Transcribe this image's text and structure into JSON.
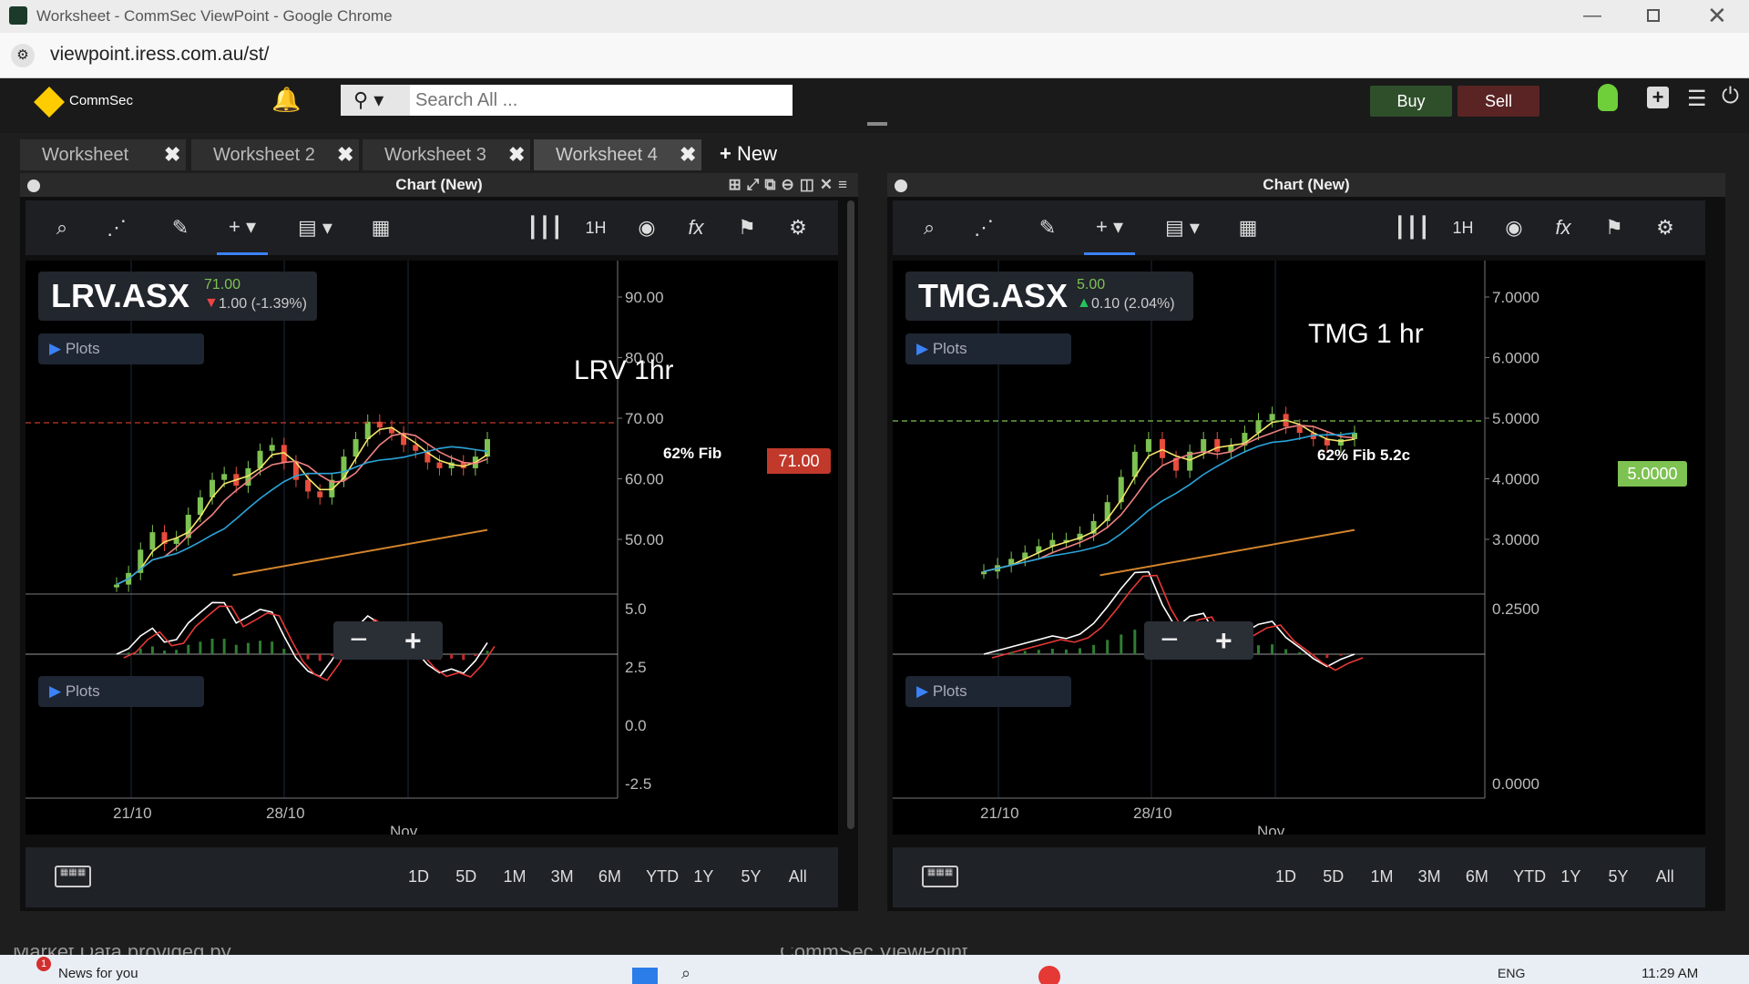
{
  "window_title": "Worksheet - CommSec ViewPoint - Google Chrome",
  "address": "viewpoint.iress.com.au/st/",
  "brand": "CommSec",
  "search_placeholder": "Search All ...",
  "buy_label": "Buy",
  "sell_label": "Sell",
  "tabs": [
    {
      "label": "Worksheet"
    },
    {
      "label": "Worksheet 2"
    },
    {
      "label": "Worksheet 3"
    },
    {
      "label": "Worksheet 4"
    }
  ],
  "new_tab_label": "New",
  "footer_text": "Market Data provided by",
  "footer_center": "CommSec ViewPoint",
  "taskbar": {
    "news": "News for you",
    "lang": "ENG",
    "time": "11:29 AM",
    "badge": "1"
  },
  "colors": {
    "accent_yellow": "#ffcc00",
    "buy": "#2e4f2a",
    "sell": "#5a2424",
    "up": "#22c55e",
    "down": "#ef4444",
    "price_left": "#c0392b",
    "price_right": "#7ec252"
  },
  "charts": [
    {
      "panel_title": "Chart (New)",
      "symbol": "LRV.ASX",
      "price": "71.00",
      "change": "1.00 (-1.39%)",
      "direction": "down",
      "annotation": "LRV 1hr",
      "fib_label": "62% Fib",
      "price_tag": "71.00",
      "plots_label": "Plots",
      "interval": "1H",
      "y_ticks": [
        "90.00",
        "80.00",
        "70.00",
        "60.00",
        "50.00"
      ],
      "osc_ticks": [
        "5.0",
        "2.5",
        "0.0",
        "-2.5"
      ],
      "x_ticks": [
        "21/10",
        "28/10",
        "Nov"
      ],
      "ranges": [
        "1D",
        "5D",
        "1M",
        "3M",
        "6M",
        "YTD",
        "1Y",
        "5Y",
        "All"
      ],
      "ylim": [
        45,
        97
      ],
      "close_series": [
        46,
        48,
        52,
        55,
        53,
        54,
        58,
        61,
        64,
        65,
        63,
        66,
        69,
        70,
        67,
        64,
        62,
        61,
        64,
        68,
        71,
        74,
        73,
        72,
        70,
        69,
        67,
        66,
        67,
        66,
        68,
        71
      ]
    },
    {
      "panel_title": "Chart (New)",
      "symbol": "TMG.ASX",
      "price": "5.00",
      "change": "0.10 (2.04%)",
      "direction": "up",
      "annotation": "TMG 1 hr",
      "fib_label": "62% Fib 5.2c",
      "price_tag": "5.0000",
      "plots_label": "Plots",
      "interval": "1H",
      "y_ticks": [
        "7.0000",
        "6.0000",
        "5.0000",
        "4.0000",
        "3.0000"
      ],
      "osc_ticks": [
        "0.2500",
        "0.0000"
      ],
      "x_ticks": [
        "21/10",
        "28/10",
        "Nov"
      ],
      "ranges": [
        "1D",
        "5D",
        "1M",
        "3M",
        "6M",
        "YTD",
        "1Y",
        "5Y",
        "All"
      ],
      "ylim": [
        2.5,
        7.3
      ],
      "close_series": [
        2.8,
        2.9,
        3.0,
        3.1,
        3.2,
        3.3,
        3.3,
        3.4,
        3.6,
        3.9,
        4.3,
        4.7,
        4.9,
        4.6,
        4.4,
        4.7,
        4.9,
        4.7,
        4.8,
        5.0,
        5.2,
        5.3,
        5.1,
        5.0,
        4.9,
        4.8,
        4.9,
        5.0
      ]
    }
  ]
}
